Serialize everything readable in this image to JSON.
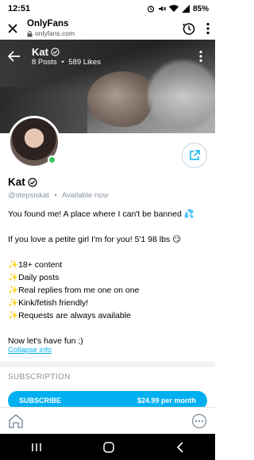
{
  "status_bar": {
    "time": "12:51",
    "battery": "85%"
  },
  "browser": {
    "title": "OnlyFans",
    "url": "onlyfans.com"
  },
  "header": {
    "name": "Kat",
    "posts": "8 Posts",
    "separator": "•",
    "likes": "589 Likes"
  },
  "profile": {
    "name": "Kat",
    "handle": "@stepsiskat",
    "dot": "•",
    "status": "Available now"
  },
  "bio": [
    "You found me! A place where I can't be banned 💦",
    "",
    "If you love a petite girl I'm for you! 5'1 98 lbs 😏",
    "",
    "✨18+ content",
    "✨Daily posts",
    "✨Real replies from me one on one",
    "✨Kink/fetish friendly!",
    "✨Requests are always available",
    "",
    "Now let's have fun ;)"
  ],
  "collapse_label": "Collapse info",
  "subscription": {
    "section_title": "SUBSCRIPTION",
    "button_label": "SUBSCRIBE",
    "price": "$24.99 per month"
  },
  "colors": {
    "accent": "#00aff0",
    "online": "#34c759",
    "muted": "#8a96a3"
  }
}
